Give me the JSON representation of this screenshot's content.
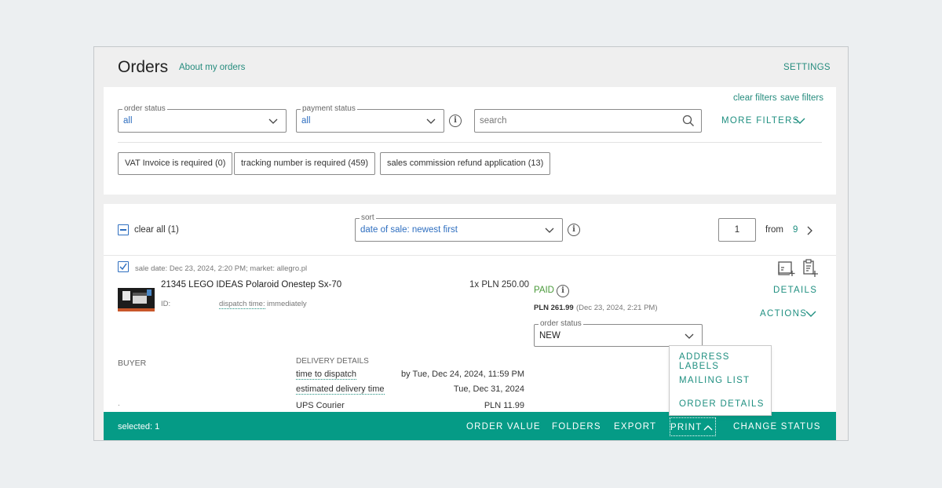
{
  "header": {
    "title": "Orders",
    "about_link": "About my orders",
    "settings": "SETTINGS"
  },
  "filters": {
    "clear_filters": "clear filters",
    "save_filters": "save filters",
    "order_status": {
      "label": "order status",
      "value": "all"
    },
    "payment_status": {
      "label": "payment status",
      "value": "all"
    },
    "search": {
      "placeholder": "search"
    },
    "more_filters": "MORE FILTERS",
    "chips": [
      "VAT Invoice is required (0)",
      "tracking number is required (459)",
      "sales commission refund application (13)"
    ]
  },
  "list_toolbar": {
    "clear_all": "clear all (1)",
    "sort": {
      "label": "sort",
      "value": "date of sale: newest first"
    },
    "page": "1",
    "from_label": "from",
    "total_pages": "9"
  },
  "order": {
    "sale_date": "sale date:  Dec 23, 2024, 2:20 PM; market: allegro.pl",
    "product_name": "21345 LEGO IDEAS Polaroid Onestep Sx-70",
    "id_label": "ID:",
    "dispatch_label": "dispatch time:",
    "dispatch_value": "immediately",
    "quantity_price": "1x PLN 250.00",
    "payment_status": "PAID",
    "paid_amount": "PLN 261.99",
    "paid_date": "(Dec 23, 2024, 2:21 PM)",
    "details": "DETAILS",
    "actions": "ACTIONS",
    "order_status": {
      "label": "order status",
      "value": "NEW"
    },
    "buyer_label": "BUYER",
    "buyer_value": ".",
    "delivery": {
      "heading": "DELIVERY DETAILS",
      "time_to_dispatch_label": "time to dispatch",
      "time_to_dispatch_value": "by Tue, Dec 24, 2024, 11:59 PM",
      "estimated_label": "estimated delivery time",
      "estimated_value": "Tue, Dec 31, 2024",
      "method": "UPS Courier",
      "cost": "PLN 11.99"
    }
  },
  "print_menu": [
    "ADDRESS LABELS",
    "MAILING LIST",
    "ORDER DETAILS"
  ],
  "bottom_bar": {
    "selected": "selected: 1",
    "order_value": "ORDER VALUE",
    "folders": "FOLDERS",
    "export": "EXPORT",
    "print": "PRINT",
    "change_status": "CHANGE STATUS"
  },
  "colors": {
    "accent": "#1f8f80",
    "bar": "#059b86",
    "select_value": "#2f6fc0",
    "paid": "#4a9a3a"
  }
}
